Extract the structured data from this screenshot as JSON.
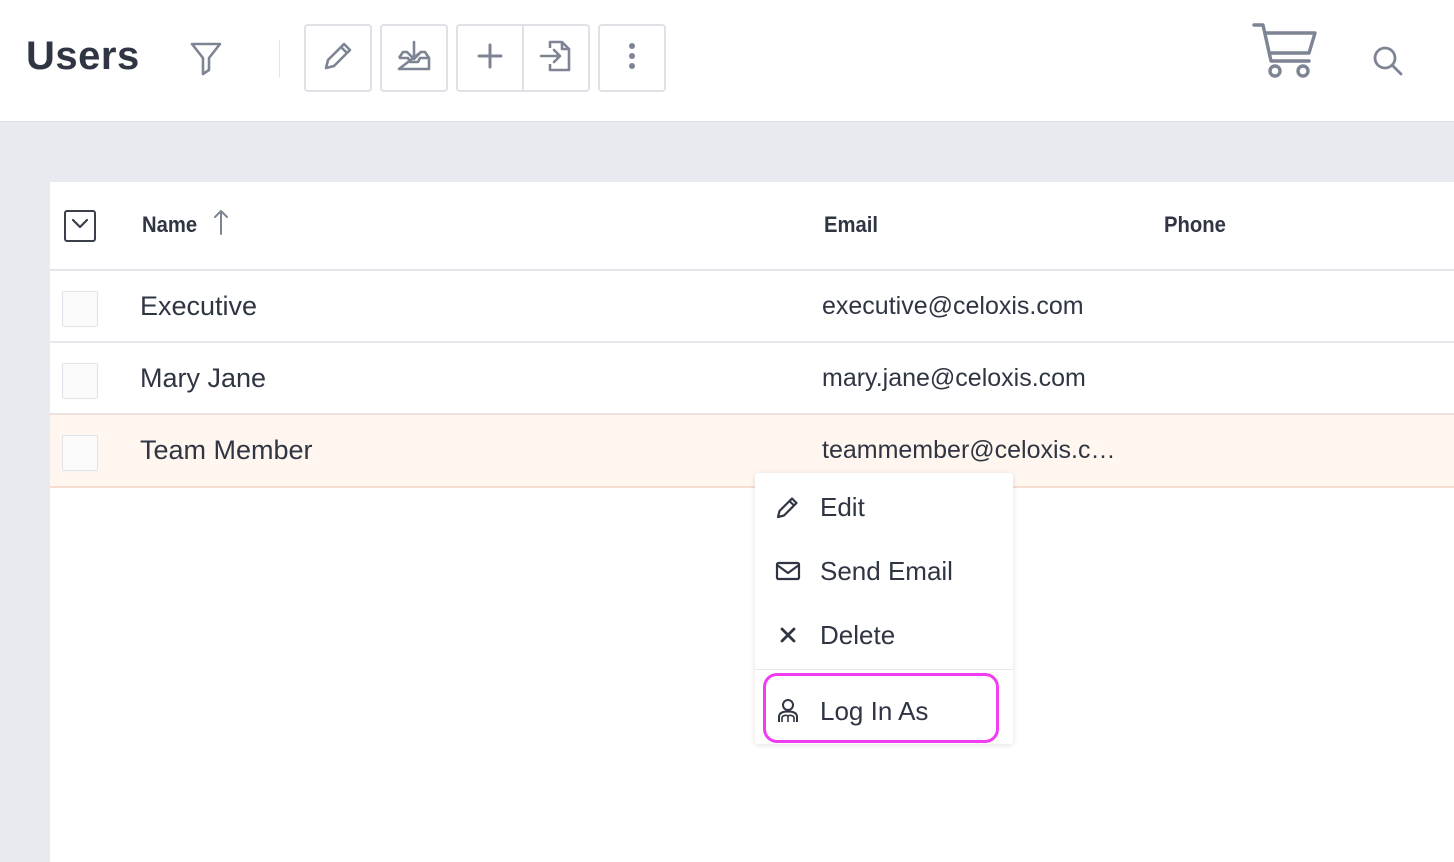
{
  "header": {
    "title": "Users",
    "toolbar": {
      "filter_icon": "filter-icon",
      "edit_icon": "pencil-icon",
      "export_icon": "download-tray-icon",
      "add_icon": "plus-icon",
      "import_icon": "file-import-icon",
      "more_icon": "vertical-ellipsis-icon"
    },
    "cart_icon": "cart-icon",
    "search_icon": "search-icon"
  },
  "table": {
    "columns": [
      {
        "label": "Name",
        "sort": "ascending"
      },
      {
        "label": "Email"
      },
      {
        "label": "Phone"
      }
    ],
    "rows": [
      {
        "name": "Executive",
        "email": "executive@celoxis.com",
        "phone": ""
      },
      {
        "name": "Mary Jane",
        "email": "mary.jane@celoxis.com",
        "phone": ""
      },
      {
        "name": "Team Member",
        "email": "teammember@celoxis.c…",
        "phone": "",
        "highlighted": true
      }
    ]
  },
  "context_menu": {
    "items": [
      {
        "label": "Edit",
        "icon": "pencil-icon"
      },
      {
        "label": "Send Email",
        "icon": "envelope-icon"
      },
      {
        "label": "Delete",
        "icon": "close-icon"
      },
      {
        "label": "Log In As",
        "icon": "user-icon",
        "highlighted": true
      }
    ]
  },
  "colors": {
    "highlight_ring": "#f13df2",
    "row_highlight": "#fff6f0",
    "icon_gray": "#7d8494",
    "text_dark": "#2f3542"
  }
}
